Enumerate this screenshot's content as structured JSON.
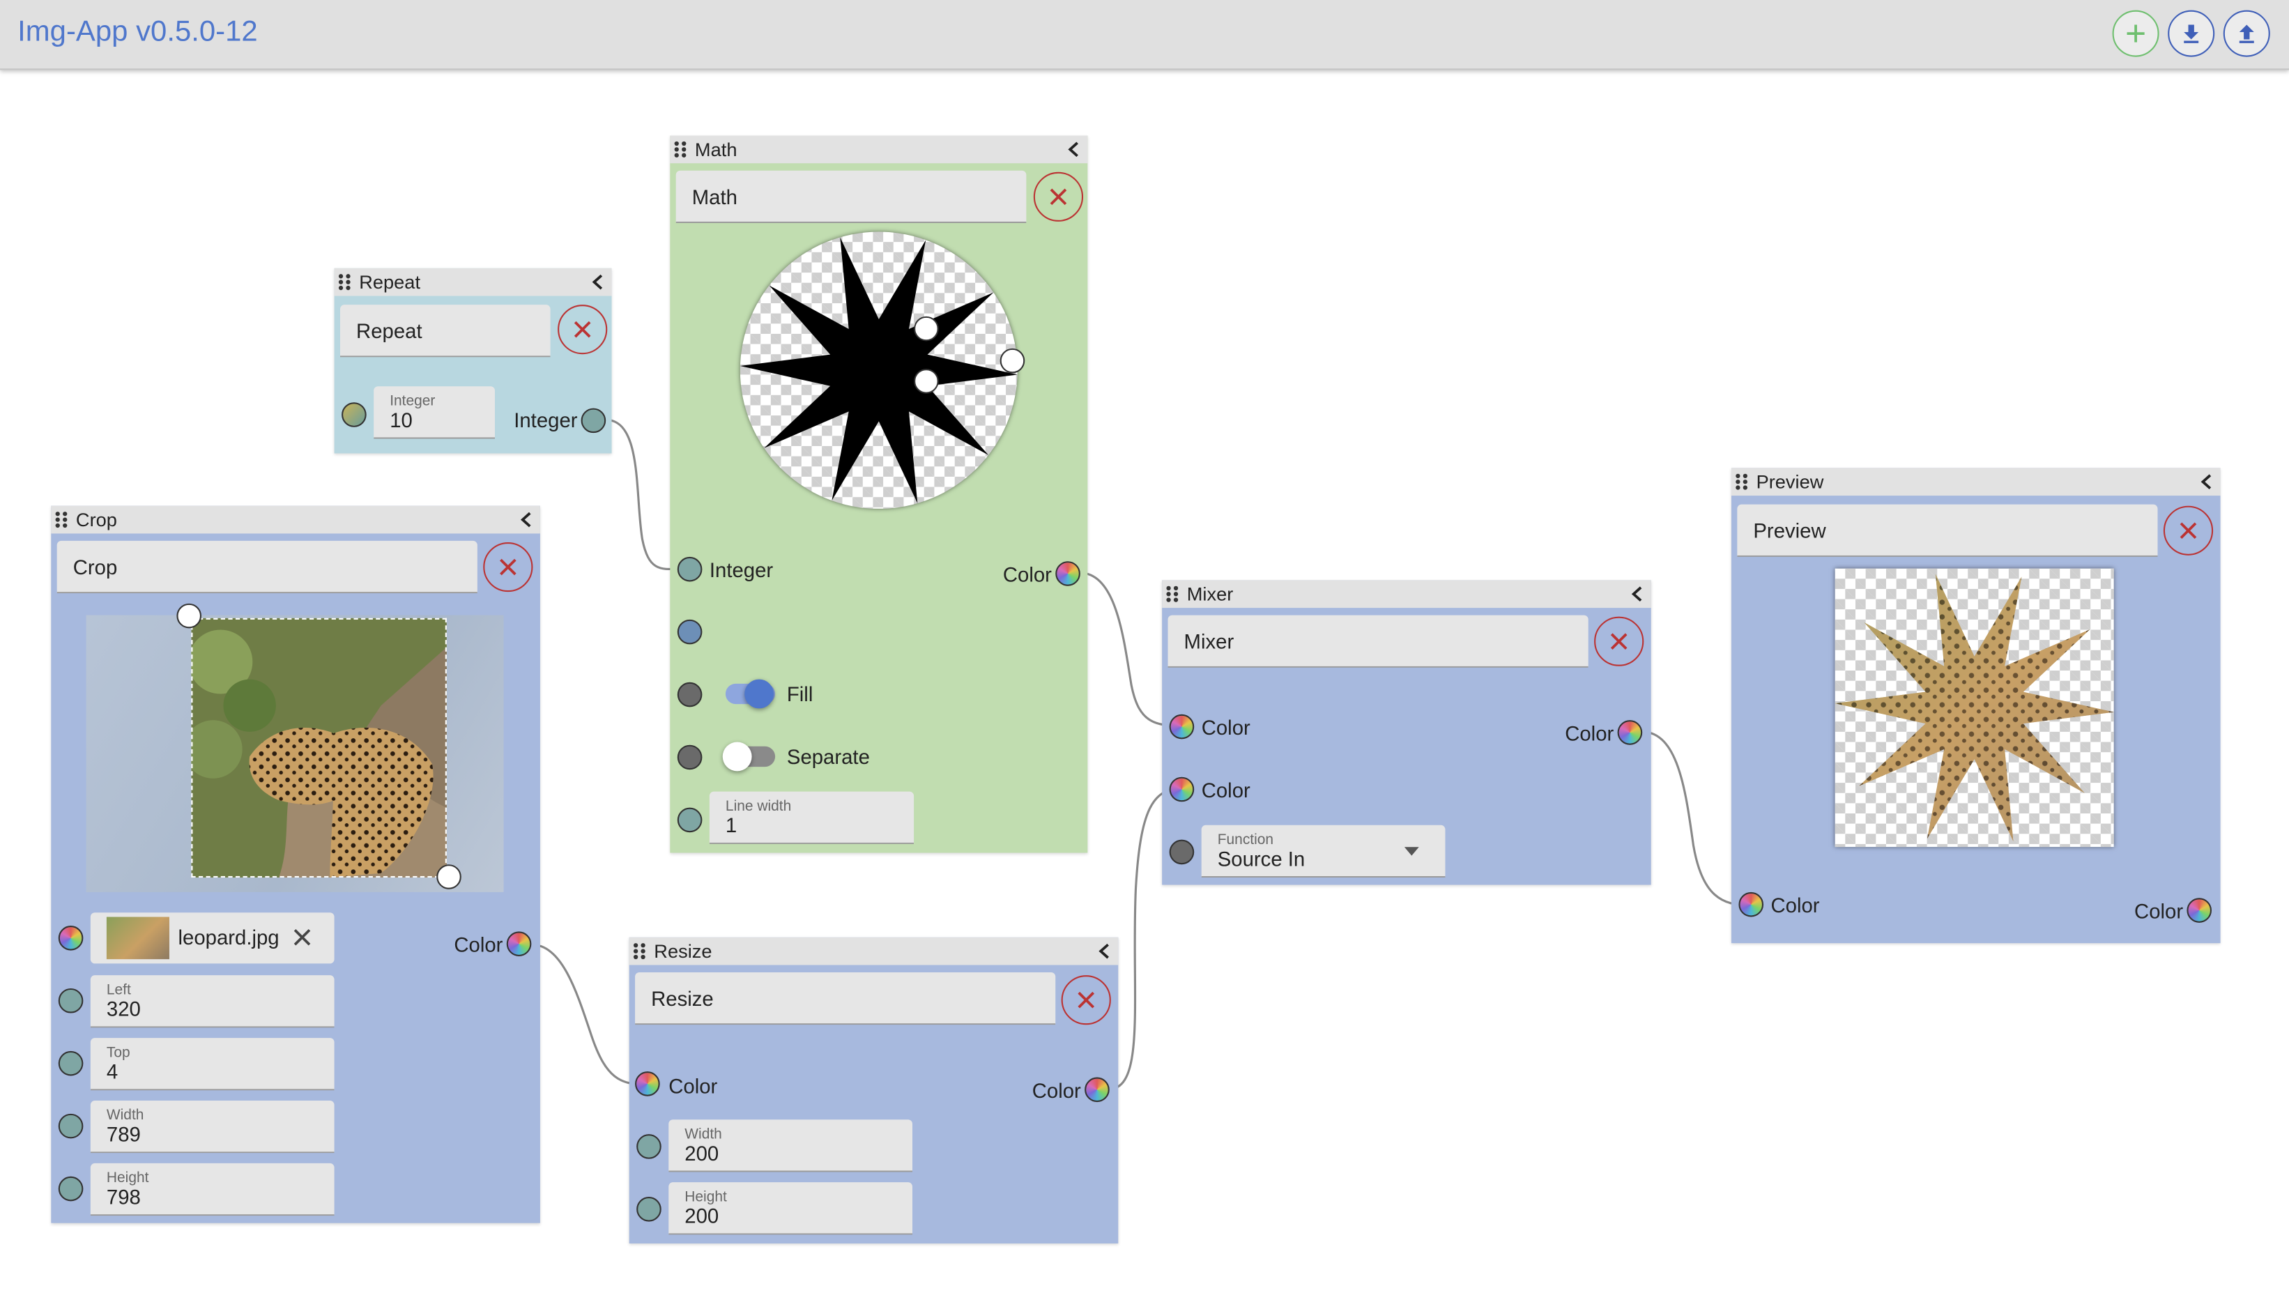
{
  "app": {
    "title": "Img-App v0.5.0-12"
  },
  "toolbar": {
    "add_icon": "plus-icon",
    "download_icon": "download-icon",
    "upload_icon": "upload-icon"
  },
  "colors": {
    "accent": "#4f77cc",
    "node_blue": "#a7b9de",
    "node_green": "#c1ddb0",
    "node_teal": "#b8d7e0",
    "close_red": "#b33333"
  },
  "nodes": {
    "repeat": {
      "title": "Repeat",
      "name": "Repeat",
      "integer_label": "Integer",
      "integer_value": "10",
      "out_label": "Integer"
    },
    "math": {
      "title": "Math",
      "name": "Math",
      "in_label": "Integer",
      "out_label": "Color",
      "fill_label": "Fill",
      "fill_on": true,
      "separate_label": "Separate",
      "separate_on": false,
      "line_width_label": "Line width",
      "line_width_value": "1"
    },
    "crop": {
      "title": "Crop",
      "name": "Crop",
      "file_name": "leopard.jpg",
      "out_label": "Color",
      "left_label": "Left",
      "left_value": "320",
      "top_label": "Top",
      "top_value": "4",
      "width_label": "Width",
      "width_value": "789",
      "height_label": "Height",
      "height_value": "798"
    },
    "resize": {
      "title": "Resize",
      "name": "Resize",
      "in_label": "Color",
      "out_label": "Color",
      "width_label": "Width",
      "width_value": "200",
      "height_label": "Height",
      "height_value": "200"
    },
    "mixer": {
      "title": "Mixer",
      "name": "Mixer",
      "in1_label": "Color",
      "in2_label": "Color",
      "out_label": "Color",
      "function_label": "Function",
      "function_value": "Source In"
    },
    "preview": {
      "title": "Preview",
      "name": "Preview",
      "in_label": "Color",
      "out_label": "Color"
    }
  }
}
